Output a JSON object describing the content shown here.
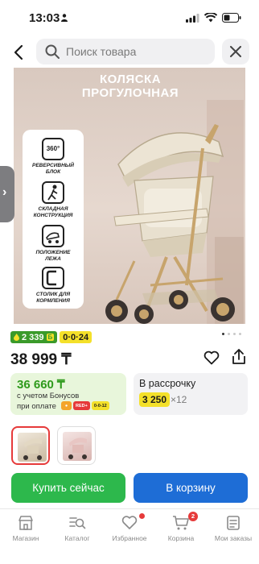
{
  "status_bar": {
    "time": "13:03"
  },
  "search": {
    "placeholder": "Поиск товара"
  },
  "product_image": {
    "title_line1": "КОЛЯСКА",
    "title_line2": "ПРОГУЛОЧНАЯ",
    "features": [
      {
        "icon": "rotate-360-icon",
        "icon_text": "360°",
        "label_line1": "РЕВЕРСИВНЫЙ",
        "label_line2": "БЛОК"
      },
      {
        "icon": "fold-person-icon",
        "icon_text": "",
        "label_line1": "СКЛАДНАЯ",
        "label_line2": "КОНСТРУКЦИЯ"
      },
      {
        "icon": "recline-icon",
        "icon_text": "",
        "label_line1": "ПОЛОЖЕНИЕ",
        "label_line2": "ЛЕЖА"
      },
      {
        "icon": "tray-icon",
        "icon_text": "",
        "label_line1": "СТОЛИК ДЛЯ",
        "label_line2": "КОРМЛЕНИЯ"
      }
    ],
    "pagination": {
      "total": 4,
      "active": 1
    }
  },
  "badges": {
    "bonus": "2 339",
    "bonus_currency": "Б",
    "installment": "0·0·24"
  },
  "price": "38 999 ₸",
  "bonus_card": {
    "amount": "36 660 ₸",
    "line1": "с учетом Бонусов",
    "line2": "при оплате",
    "logos": [
      "RED+",
      "0-0-12"
    ]
  },
  "installment_card": {
    "title": "В рассрочку",
    "amount": "3 250",
    "times": "×12"
  },
  "buttons": {
    "buy_now": "Купить сейчас",
    "add_to_cart": "В корзину"
  },
  "tabbar": [
    {
      "label": "Магазин",
      "icon": "store-icon"
    },
    {
      "label": "Каталог",
      "icon": "catalog-search-icon"
    },
    {
      "label": "Избранное",
      "icon": "heart-icon",
      "dot": true
    },
    {
      "label": "Корзина",
      "icon": "cart-icon",
      "count": "2"
    },
    {
      "label": "Мои заказы",
      "icon": "orders-icon"
    }
  ],
  "colors": {
    "buy": "#2db84c",
    "cart": "#1e6dd6",
    "bonus_green": "#3a9a2a",
    "badge_yellow": "#f4e02a",
    "alert_red": "#e63a3a"
  }
}
